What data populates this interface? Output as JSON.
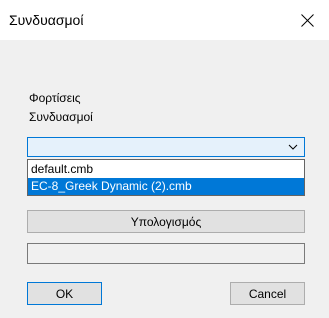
{
  "window": {
    "title": "Συνδυασμοί",
    "close_icon": "close-icon"
  },
  "labels": {
    "loads": "Φορτίσεις",
    "combinations": "Συνδυασμοί"
  },
  "combo": {
    "value": "",
    "chevron_icon": "chevron-down-icon",
    "options": [
      "default.cmb",
      "EC-8_Greek Dynamic (2).cmb"
    ],
    "highlighted_option": "EC-8_Greek Dynamic (2).cmb"
  },
  "buttons": {
    "calculate": "Υπολογισμός",
    "ok": "OK",
    "cancel": "Cancel"
  },
  "colors": {
    "accent": "#0078d7",
    "combo_bg": "#e5f1fb"
  }
}
